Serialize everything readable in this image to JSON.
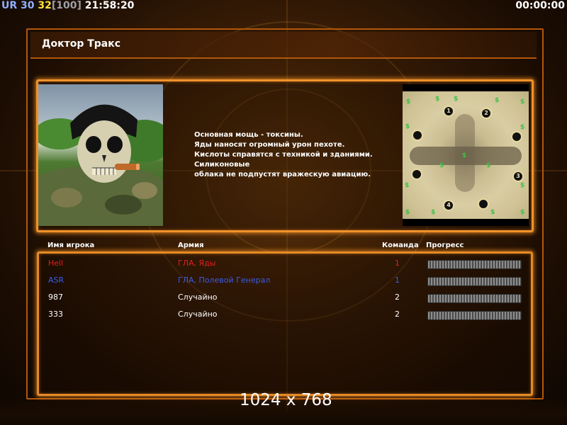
{
  "hud": {
    "ur": "UR",
    "num1": "30",
    "num2": "32",
    "bracket": "[100]",
    "clock": "21:58:20",
    "timer": "00:00:00"
  },
  "title": "Доктор Тракс",
  "description": [
    "Основная мощь - токсины.",
    "Яды наносят огромный урон пехоте.",
    "Кислоты справятся с техникой и зданиями.",
    "Силиконовые",
    "облака не подпустят вражескую авиацию."
  ],
  "minimap": {
    "spawns": [
      "1",
      "2",
      "3",
      "4"
    ],
    "supply_symbol": "$"
  },
  "table": {
    "headers": {
      "player": "Имя игрока",
      "army": "Армия",
      "team": "Команда",
      "progress": "Прогресс"
    },
    "rows": [
      {
        "name": "Hell",
        "army": "ГЛА, Яды",
        "team": "1",
        "color": "#e02020",
        "progress": 0
      },
      {
        "name": "ASR",
        "army": "ГЛА, Полевой Генерал",
        "team": "1",
        "color": "#3a5ce8",
        "progress": 0
      },
      {
        "name": "987",
        "army": "Случайно",
        "team": "2",
        "color": "#ffffff",
        "progress": 0
      },
      {
        "name": "333",
        "army": "Случайно",
        "team": "2",
        "color": "#ffffff",
        "progress": 0
      }
    ]
  },
  "resolution": "1024 x 768",
  "colors": {
    "frame_orange": "#f0922a",
    "player_red": "#e02020",
    "player_blue": "#3a5ce8"
  }
}
